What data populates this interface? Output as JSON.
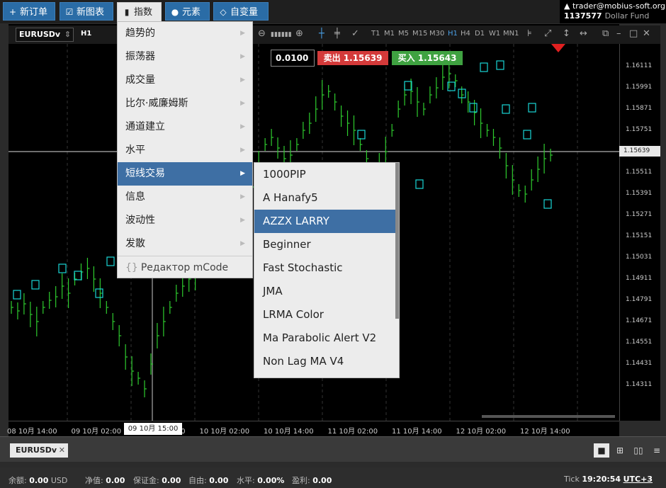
{
  "toolbar": {
    "new_order": "新订单",
    "new_chart": "新图表",
    "indicators": "指数",
    "elements": "元素",
    "variables": "自变量"
  },
  "account": {
    "email": "trader@mobius-soft.org",
    "number": "1137577",
    "type": "Dollar Fund"
  },
  "chart": {
    "symbol": "EURUSDv",
    "timeframe": "H1",
    "timeframes": [
      "T1",
      "M1",
      "M5",
      "M15",
      "M30",
      "H1",
      "H4",
      "D1",
      "W1",
      "MN1"
    ],
    "active_timeframe": "H1",
    "lot": "0.0100",
    "sell_label": "卖出 1.15639",
    "buy_label": "买入 1.15643",
    "current_price": "1.15639",
    "price_ticks": [
      "1.16111",
      "1.15991",
      "1.15871",
      "1.15751",
      "1.15631",
      "1.15511",
      "1.15391",
      "1.15271",
      "1.15151",
      "1.15031",
      "1.14911",
      "1.14791",
      "1.14671",
      "1.14551",
      "1.14431",
      "1.14311"
    ],
    "time_ticks": [
      "08 10月 14:00",
      "09 10月 02:00",
      "09 10月 14:00",
      "10 10月 02:00",
      "10 10月 14:00",
      "11 10月 02:00",
      "11 10月 14:00",
      "12 10月 02:00",
      "12 10月 14:00"
    ],
    "time_cursor": "09 10月 15:00",
    "colors": {
      "up": "#2ecc2e",
      "marker": "#19d6d6",
      "sell": "#d43a3a",
      "buy": "#3fa241"
    }
  },
  "menu_main": [
    {
      "label": "趋势的"
    },
    {
      "label": "振荡器"
    },
    {
      "label": "成交量"
    },
    {
      "label": "比尔·威廉姆斯"
    },
    {
      "label": "通道建立"
    },
    {
      "label": "水平"
    },
    {
      "label": "短线交易"
    },
    {
      "label": "信息"
    },
    {
      "label": "波动性"
    },
    {
      "label": "发散"
    },
    {
      "label": "Редактор mCode"
    }
  ],
  "menu_sub": [
    {
      "label": "1000PIP"
    },
    {
      "label": "A Hanafy5"
    },
    {
      "label": "AZZX LARRY"
    },
    {
      "label": "Beginner"
    },
    {
      "label": "Fast Stochastic"
    },
    {
      "label": "JMA"
    },
    {
      "label": "LRMA Color"
    },
    {
      "label": "Ma Parabolic Alert V2"
    },
    {
      "label": "Non Lag MA V4"
    }
  ],
  "bottom": {
    "tab_symbol": "EURUSDv",
    "balance_label": "余额:",
    "balance_value": "0.00",
    "balance_ccy": "USD",
    "equity_label": "净值:",
    "equity_value": "0.00",
    "margin_label": "保证金:",
    "margin_value": "0.00",
    "free_label": "自由:",
    "free_value": "0.00",
    "level_label": "水平:",
    "level_value": "0.00%",
    "profit_label": "盈利:",
    "profit_value": "0.00",
    "tick_label": "Tick",
    "time_value": "19:20:54",
    "tz_value": "UTC+3"
  }
}
